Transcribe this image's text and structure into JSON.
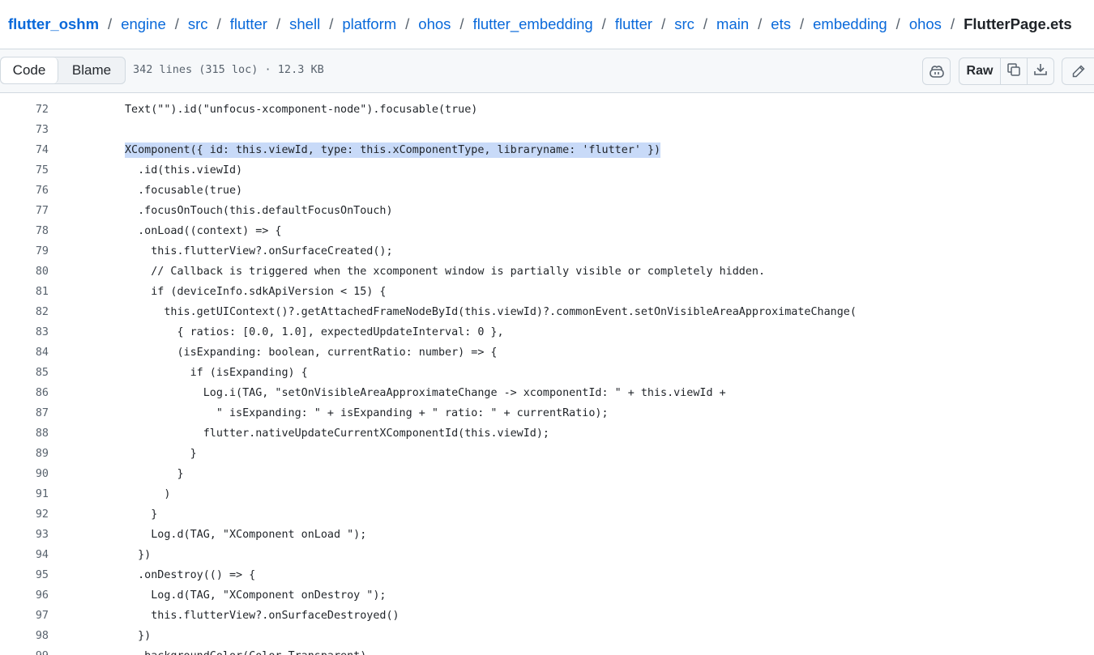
{
  "breadcrumb": {
    "repo": "flutter_oshm",
    "segments": [
      "engine",
      "src",
      "flutter",
      "shell",
      "platform",
      "ohos",
      "flutter_embedding",
      "flutter",
      "src",
      "main",
      "ets",
      "embedding",
      "ohos"
    ],
    "separator": "/",
    "current_file": "FlutterPage.ets"
  },
  "toolbar": {
    "code_tab": "Code",
    "blame_tab": "Blame",
    "file_meta": "342 lines (315 loc) · 12.3 KB",
    "raw_label": "Raw",
    "icons": {
      "copilot": "copilot-icon",
      "copy": "copy-icon",
      "download": "download-icon",
      "edit": "pencil-icon"
    }
  },
  "code": {
    "selected_line": 74,
    "lines": [
      {
        "num": "72",
        "indent": 0,
        "text": "Text(\"\").id(\"unfocus-xcomponent-node\").focusable(true)"
      },
      {
        "num": "73",
        "indent": 0,
        "text": ""
      },
      {
        "num": "74",
        "indent": 0,
        "text": "XComponent({ id: this.viewId, type: this.xComponentType, libraryname: 'flutter' })"
      },
      {
        "num": "75",
        "indent": 2,
        "text": ".id(this.viewId)"
      },
      {
        "num": "76",
        "indent": 2,
        "text": ".focusable(true)"
      },
      {
        "num": "77",
        "indent": 2,
        "text": ".focusOnTouch(this.defaultFocusOnTouch)"
      },
      {
        "num": "78",
        "indent": 2,
        "text": ".onLoad((context) => {"
      },
      {
        "num": "79",
        "indent": 4,
        "text": "this.flutterView?.onSurfaceCreated();"
      },
      {
        "num": "80",
        "indent": 4,
        "text": "// Callback is triggered when the xcomponent window is partially visible or completely hidden."
      },
      {
        "num": "81",
        "indent": 4,
        "text": "if (deviceInfo.sdkApiVersion < 15) {"
      },
      {
        "num": "82",
        "indent": 6,
        "text": "this.getUIContext()?.getAttachedFrameNodeById(this.viewId)?.commonEvent.setOnVisibleAreaApproximateChange("
      },
      {
        "num": "83",
        "indent": 8,
        "text": "{ ratios: [0.0, 1.0], expectedUpdateInterval: 0 },"
      },
      {
        "num": "84",
        "indent": 8,
        "text": "(isExpanding: boolean, currentRatio: number) => {"
      },
      {
        "num": "85",
        "indent": 10,
        "text": "if (isExpanding) {"
      },
      {
        "num": "86",
        "indent": 12,
        "text": "Log.i(TAG, \"setOnVisibleAreaApproximateChange -> xcomponentId: \" + this.viewId +"
      },
      {
        "num": "87",
        "indent": 14,
        "text": "\" isExpanding: \" + isExpanding + \" ratio: \" + currentRatio);"
      },
      {
        "num": "88",
        "indent": 12,
        "text": "flutter.nativeUpdateCurrentXComponentId(this.viewId);"
      },
      {
        "num": "89",
        "indent": 10,
        "text": "}"
      },
      {
        "num": "90",
        "indent": 8,
        "text": "}"
      },
      {
        "num": "91",
        "indent": 6,
        "text": ")"
      },
      {
        "num": "92",
        "indent": 4,
        "text": "}"
      },
      {
        "num": "93",
        "indent": 4,
        "text": "Log.d(TAG, \"XComponent onLoad \");"
      },
      {
        "num": "94",
        "indent": 2,
        "text": "})"
      },
      {
        "num": "95",
        "indent": 2,
        "text": ".onDestroy(() => {"
      },
      {
        "num": "96",
        "indent": 4,
        "text": "Log.d(TAG, \"XComponent onDestroy \");"
      },
      {
        "num": "97",
        "indent": 4,
        "text": "this.flutterView?.onSurfaceDestroyed()"
      },
      {
        "num": "98",
        "indent": 2,
        "text": "})"
      },
      {
        "num": "99",
        "indent": 2,
        "text": ".backgroundColor(Color.Transparent)"
      }
    ]
  },
  "colors": {
    "link": "#0969da",
    "selection": "#c8daf8",
    "border": "#d1d9e0",
    "muted": "#59636e"
  }
}
